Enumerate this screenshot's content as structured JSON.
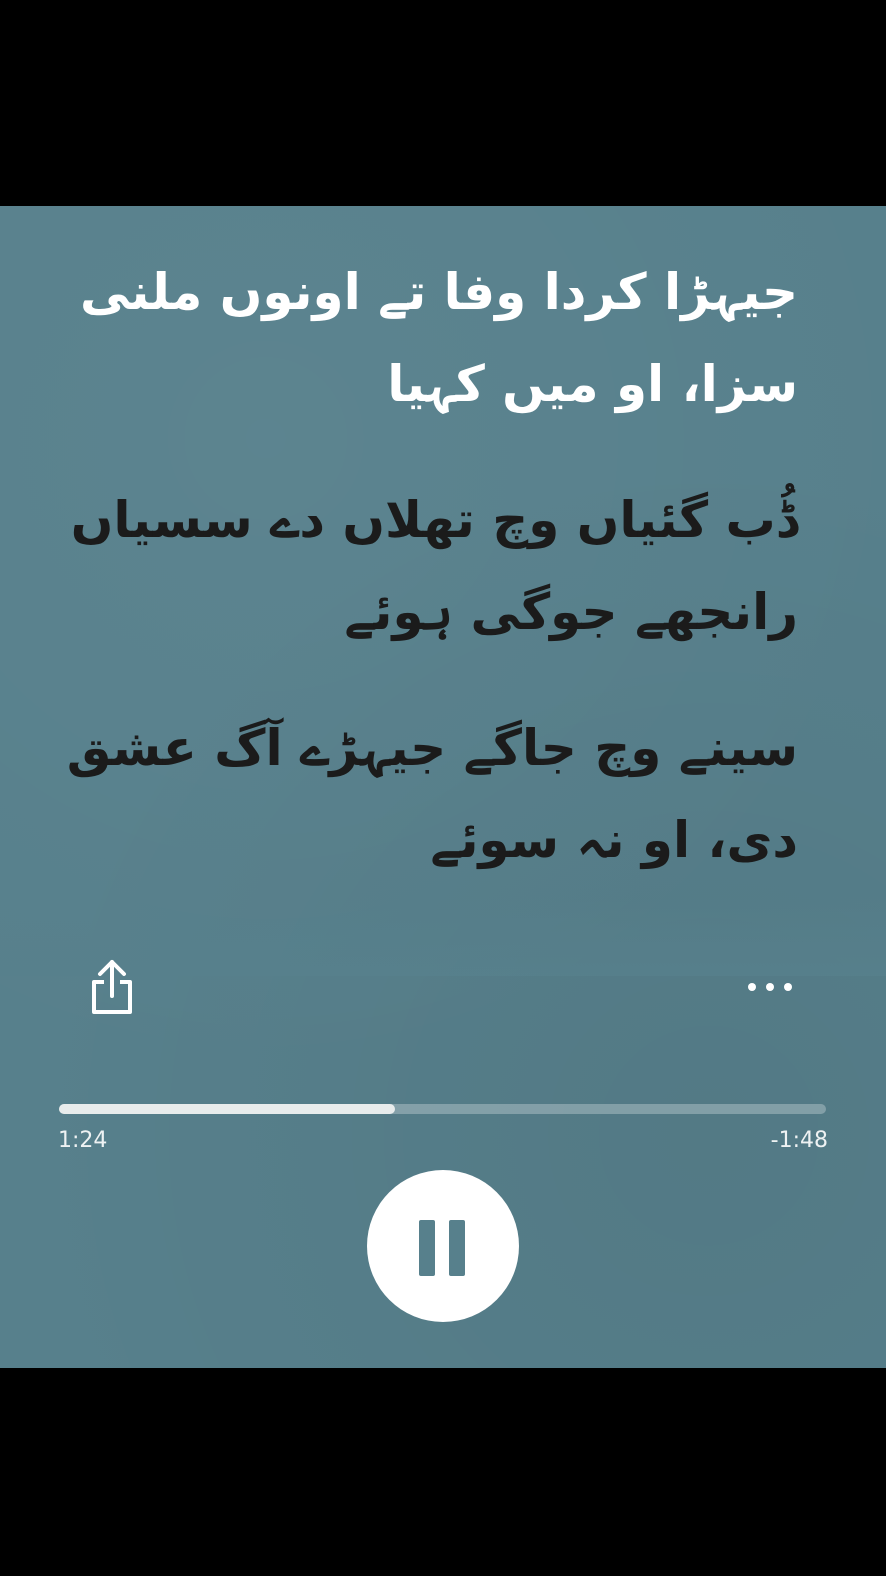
{
  "lyrics": [
    {
      "text": "جیہڑا کردا وفا تے اونوں ملنی سزا، او میں کہیا",
      "state": "active"
    },
    {
      "text": "ڈُب گئیاں وچ تھلاں دے سسیاں رانجھے جوگی ہوئے",
      "state": "upcoming"
    },
    {
      "text": "سینے وچ جاگے جیہڑے آگ عشق دی، او نہ سوئے",
      "state": "upcoming"
    }
  ],
  "controls": {
    "share_icon": "share-icon",
    "more_icon": "more-options-icon",
    "pause_icon": "pause-icon"
  },
  "playback": {
    "elapsed": "1:24",
    "remaining": "-1:48",
    "progress_fraction": 0.4375,
    "is_playing": true
  },
  "colors": {
    "background": "#57808c",
    "active_lyric": "#ffffff",
    "upcoming_lyric": "#1b1b1b"
  }
}
